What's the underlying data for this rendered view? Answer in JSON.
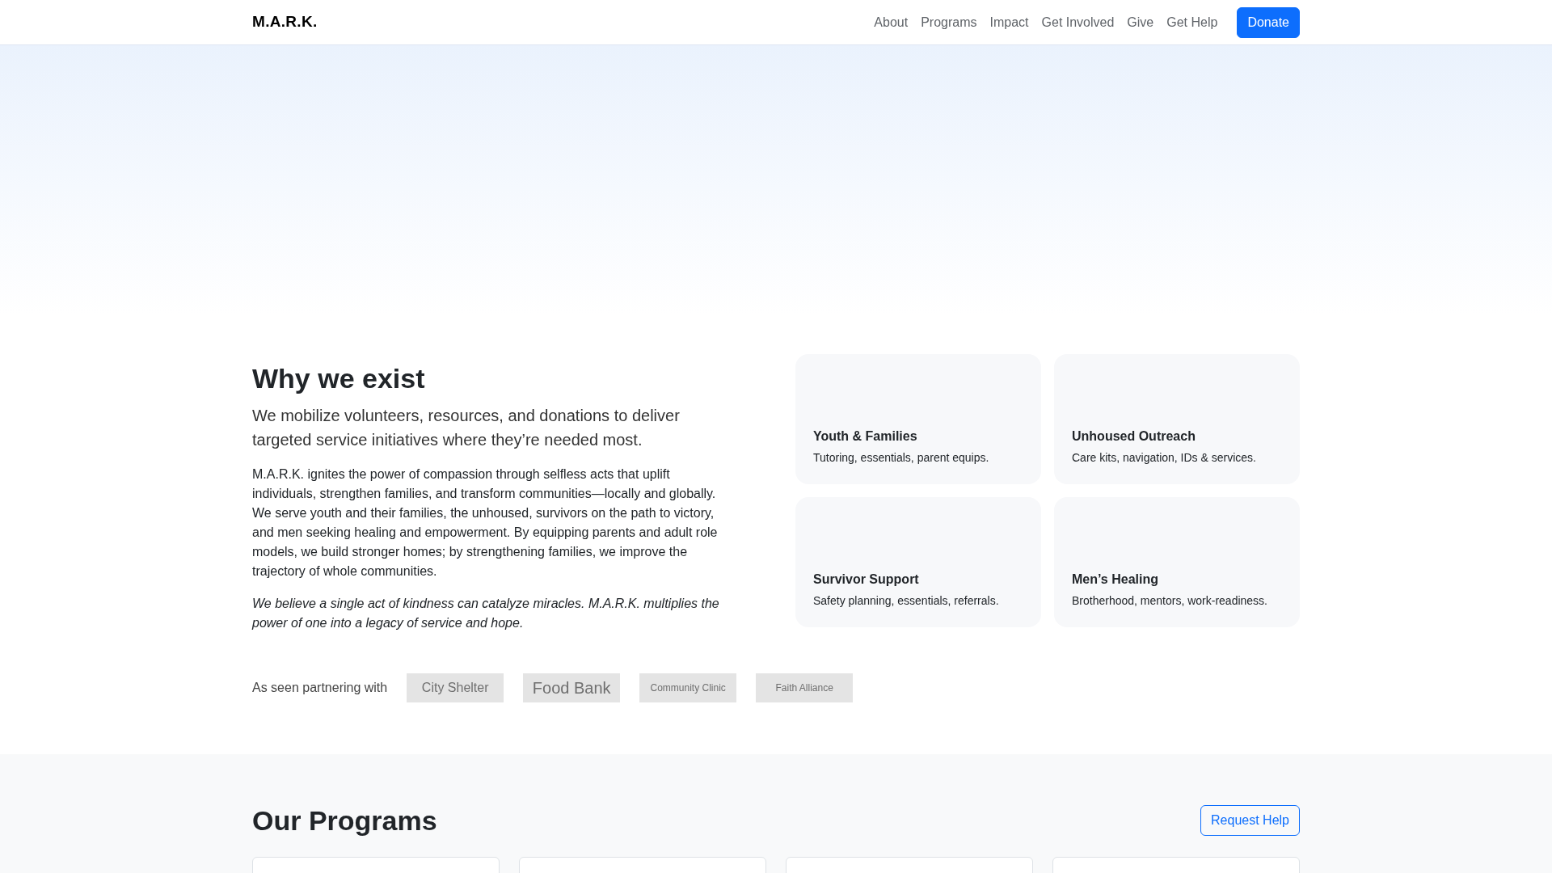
{
  "navbar": {
    "brand": "M.A.R.K.",
    "links": [
      "About",
      "Programs",
      "Impact",
      "Get Involved",
      "Give",
      "Get Help"
    ],
    "cta": "Donate"
  },
  "about": {
    "heading": "Why we exist",
    "lead": "We mobilize volunteers, resources, and donations to deliver targeted service initiatives where they’re needed most.",
    "body": "M.A.R.K. ignites the power of compassion through selfless acts that uplift individuals, strengthen families, and transform communities—locally and globally. We serve youth and their families, the unhoused, survivors on the path to victory, and men seeking healing and empowerment. By equipping parents and adult role models, we build stronger homes; by strengthening families, we improve the trajectory of whole communities.",
    "belief": "We believe a single act of kindness can catalyze miracles. M.A.R.K. multiplies the power of one into a legacy of service and hope.",
    "focus_cards": [
      {
        "title": "Youth & Families",
        "text": "Tutoring, essentials, parent equips."
      },
      {
        "title": "Unhoused Outreach",
        "text": "Care kits, navigation, IDs & services."
      },
      {
        "title": "Survivor Support",
        "text": "Safety planning, essentials, referrals."
      },
      {
        "title": "Men’s Healing",
        "text": "Brotherhood, mentors, work-readiness."
      }
    ]
  },
  "partners": {
    "label": "As seen partnering with",
    "logos": [
      {
        "name": "City Shelter"
      },
      {
        "name": "Food Bank"
      },
      {
        "name": "Community Clinic"
      },
      {
        "name": "Faith Alliance"
      }
    ]
  },
  "programs": {
    "heading": "Our Programs",
    "button": "Request Help"
  }
}
